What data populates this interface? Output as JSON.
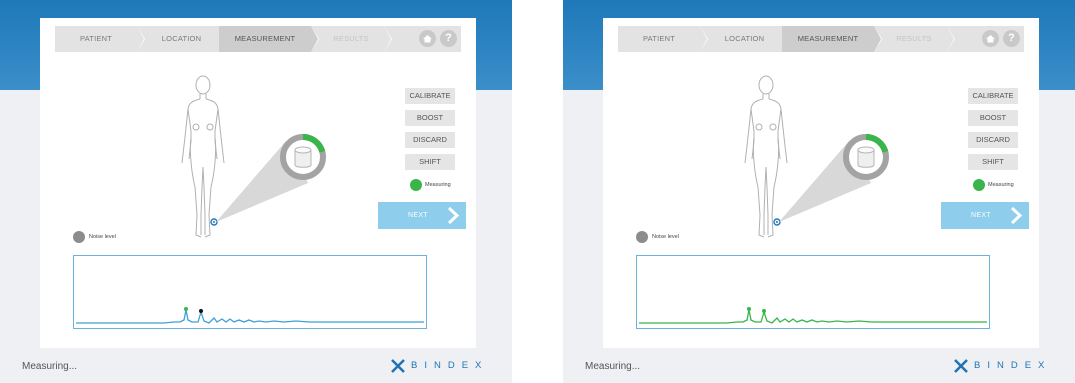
{
  "screens": [
    {
      "steps": [
        "PATIENT",
        "LOCATION",
        "MEASUREMENT",
        "RESULTS"
      ],
      "buttons": [
        "CALIBRATE",
        "BOOST",
        "DISCARD",
        "SHIFT"
      ],
      "measuring_label": "Measuring",
      "next_label": "NEXT",
      "noise_label": "Noise level",
      "status_text": "Measuring...",
      "brand": "BINDEX",
      "colors": {
        "signal": "#3fa0d8",
        "indicator": "#39b54a",
        "noise": "#8c8c8c"
      },
      "graph": {
        "peak_markers": [
          "green",
          "black"
        ]
      },
      "icons": [
        "home-icon",
        "help-icon",
        "chevron-right-icon",
        "body-outline",
        "sensor-gauge-icon"
      ]
    },
    {
      "steps": [
        "PATIENT",
        "LOCATION",
        "MEASUREMENT",
        "RESULTS"
      ],
      "buttons": [
        "CALIBRATE",
        "BOOST",
        "DISCARD",
        "SHIFT"
      ],
      "measuring_label": "Measuring",
      "next_label": "NEXT",
      "noise_label": "Noise level",
      "status_text": "Measuring...",
      "brand": "BINDEX",
      "colors": {
        "signal": "#39b54a",
        "indicator": "#39b54a",
        "noise": "#8c8c8c"
      },
      "graph": {
        "peak_markers": [
          "green",
          "green"
        ]
      },
      "icons": [
        "home-icon",
        "help-icon",
        "chevron-right-icon",
        "body-outline",
        "sensor-gauge-icon"
      ]
    }
  ]
}
